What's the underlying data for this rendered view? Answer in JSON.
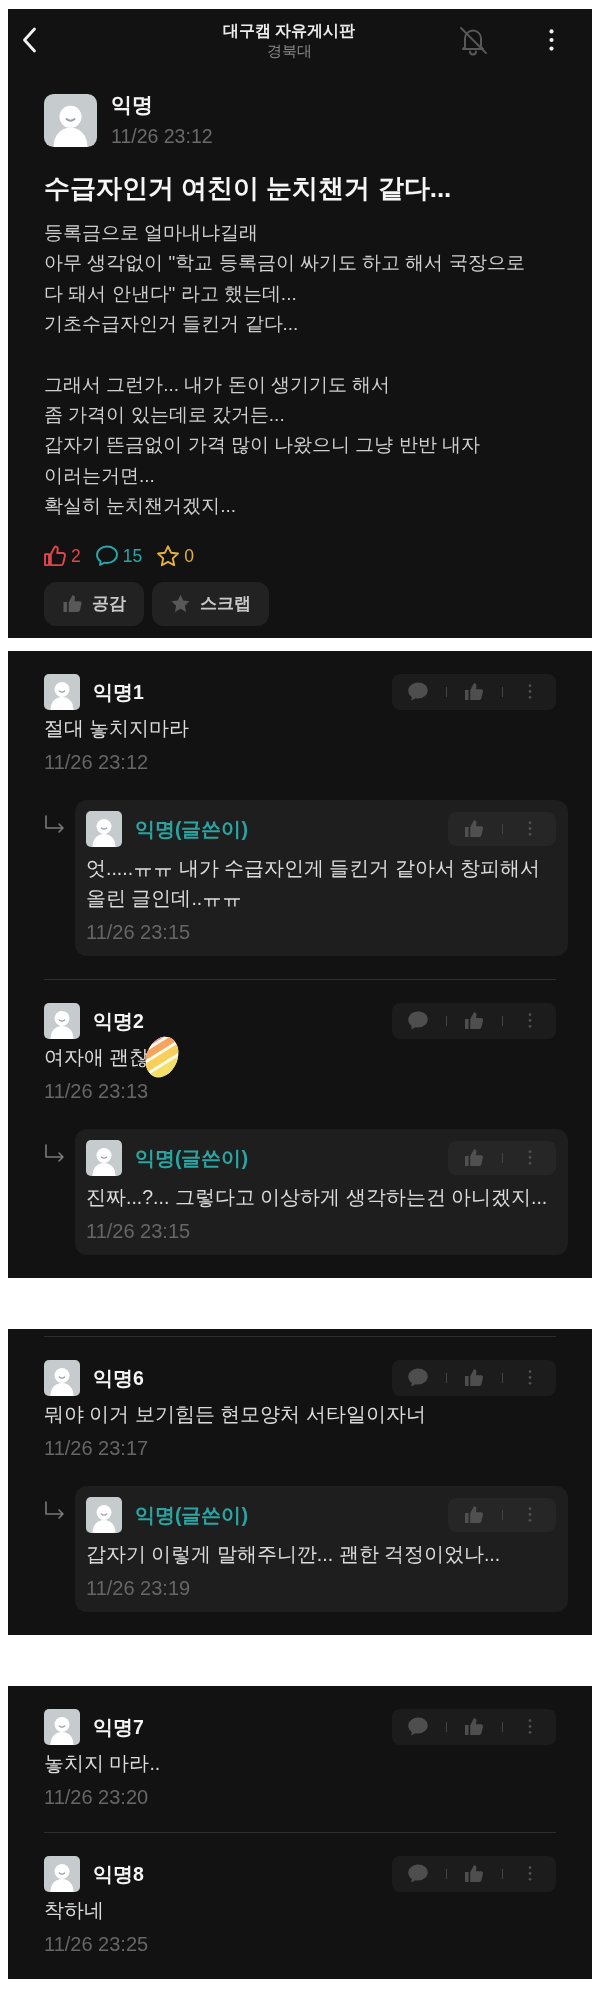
{
  "header": {
    "title": "대구캠 자유게시판",
    "subtitle": "경북대"
  },
  "post": {
    "author": "익명",
    "time": "11/26 23:12",
    "title": "수급자인거 여친이 눈치챈거 같다...",
    "body": [
      [
        "등록금으로 얼마내냐길래",
        "아무 생각없이 \"학교 등록금이 싸기도 하고 해서 국장으로",
        "다 돼서 안낸다\" 라고 했는데...",
        "기초수급자인거 들킨거 같다..."
      ],
      [
        "그래서 그런가... 내가 돈이 생기기도 해서",
        "좀 가격이 있는데로 갔거든...",
        "갑자기 뜬금없이 가격 많이 나왔으니 그냥 반반 내자",
        "이러는거면...",
        "확실히 눈치챈거겠지..."
      ]
    ],
    "counts": [
      {
        "kind": "like",
        "value": "2",
        "color": "#e2474b"
      },
      {
        "kind": "comment",
        "value": "15",
        "color": "#2aa6a9"
      },
      {
        "kind": "scrap",
        "value": "0",
        "color": "#e3b33c"
      }
    ],
    "buttons": [
      {
        "kind": "like",
        "label": "공감"
      },
      {
        "kind": "scrap",
        "label": "스크랩"
      }
    ]
  },
  "comment_groups": [
    {
      "divider_top": false,
      "comments": [
        {
          "author": "익명1",
          "is_author": false,
          "content": [
            "절대 놓치지마라"
          ],
          "emoji": false,
          "time": "11/26 23:12",
          "replies": [
            {
              "author": "익명(글쓴이)",
              "is_author": true,
              "content": [
                "엇.....ㅠㅠ 내가 수급자인게 들킨거 같아서 창피해서",
                "올린 글인데..ㅠㅠ"
              ],
              "time": "11/26 23:15"
            }
          ]
        },
        {
          "author": "익명2",
          "is_author": false,
          "content": [
            "여자애 괜찮"
          ],
          "emoji": true,
          "time": "11/26 23:13",
          "replies": [
            {
              "author": "익명(글쓴이)",
              "is_author": true,
              "content": [
                "진짜...?... 그렇다고 이상하게 생각하는건 아니겠지..."
              ],
              "time": "11/26 23:15"
            }
          ]
        }
      ]
    },
    {
      "divider_top": true,
      "comments": [
        {
          "author": "익명6",
          "is_author": false,
          "content": [
            "뭐야 이거 보기힘든 현모양처 서타일이자너"
          ],
          "emoji": false,
          "time": "11/26 23:17",
          "replies": [
            {
              "author": "익명(글쓴이)",
              "is_author": true,
              "content": [
                "갑자기 이렇게 말해주니깐... 괜한 걱정이었나..."
              ],
              "time": "11/26 23:19"
            }
          ]
        }
      ]
    },
    {
      "divider_top": false,
      "comments": [
        {
          "author": "익명7",
          "is_author": false,
          "content": [
            "놓치지 마라.."
          ],
          "emoji": false,
          "time": "11/26 23:20"
        },
        {
          "author": "익명8",
          "is_author": false,
          "content": [
            "착하네"
          ],
          "emoji": false,
          "time": "11/26 23:25"
        }
      ]
    }
  ]
}
